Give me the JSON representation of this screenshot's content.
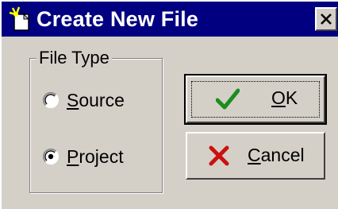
{
  "window": {
    "title": "Create New File",
    "title_icon": "sparkle-new-file-icon",
    "close_icon": "close-icon"
  },
  "file_type": {
    "group_label": "File Type",
    "options": [
      {
        "mnemonic": "S",
        "rest": "ource",
        "label": "Source",
        "selected": false
      },
      {
        "mnemonic": "P",
        "rest": "roject",
        "label": "Project",
        "selected": true
      }
    ]
  },
  "buttons": {
    "ok": {
      "mnemonic": "O",
      "rest": "K",
      "label": "OK",
      "icon": "checkmark-icon",
      "icon_color": "#1e8c1e"
    },
    "cancel": {
      "mnemonic": "C",
      "rest": "ancel",
      "label": "Cancel",
      "icon": "x-mark-icon",
      "icon_color": "#cc1010"
    }
  },
  "colors": {
    "titlebar": "#000080",
    "face": "#d4d0c8"
  }
}
